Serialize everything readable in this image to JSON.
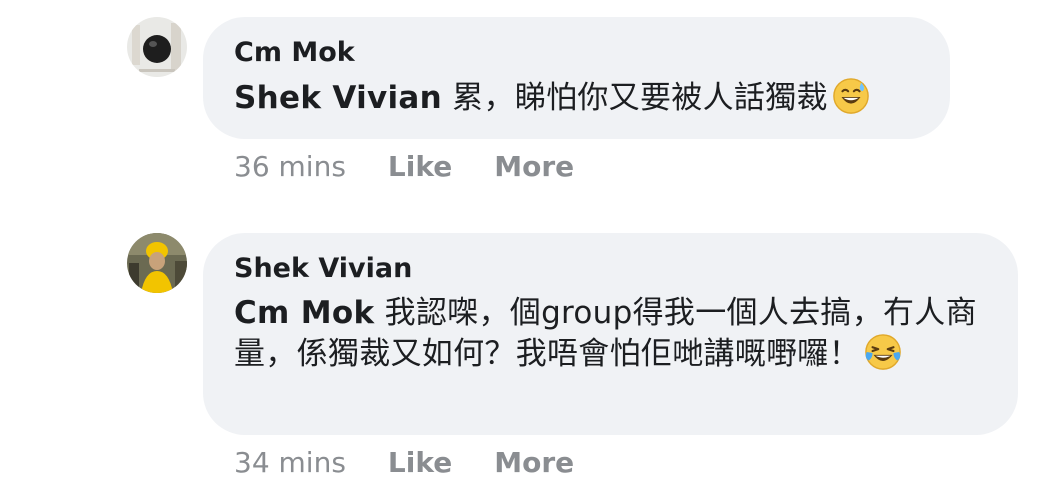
{
  "comments": [
    {
      "author": "Cm Mok",
      "mention": "Shek Vivian",
      "text": " 累，睇怕你又要被人話獨裁",
      "emoji": "sweat-smile-emoji",
      "time": "36 mins",
      "like_label": "Like",
      "more_label": "More"
    },
    {
      "author": "Shek Vivian",
      "mention": "Cm Mok",
      "text": " 我認㗎，個group得我一個人去搞，冇人商量，係獨裁又如何？我唔會怕佢哋講嘅嘢囉！",
      "emoji": "tears-of-joy-emoji",
      "time": "34 mins",
      "like_label": "Like",
      "more_label": "More"
    }
  ]
}
